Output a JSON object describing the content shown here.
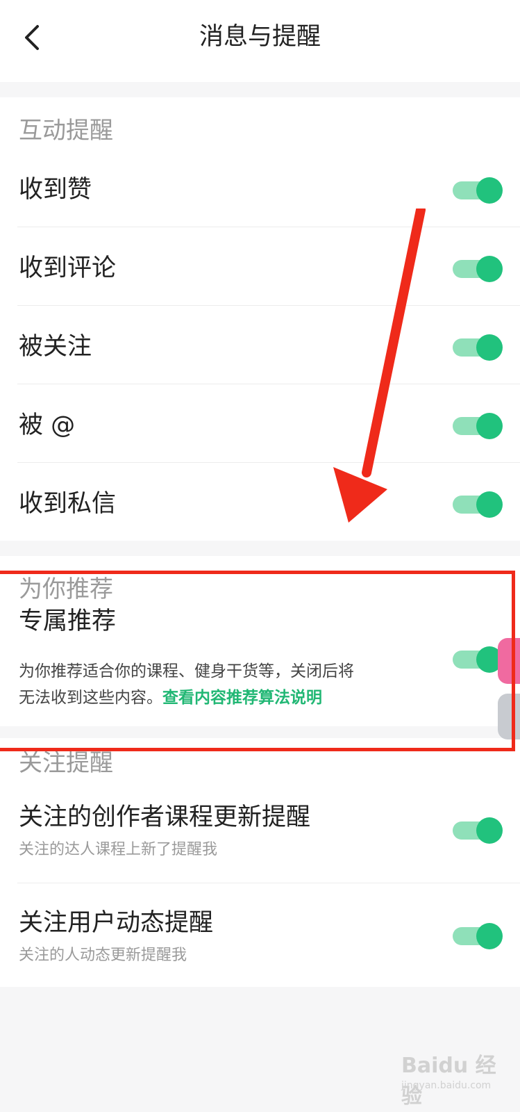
{
  "header": {
    "back_icon": "chevron-left-icon",
    "title": "消息与提醒"
  },
  "interaction": {
    "section_title": "互动提醒",
    "items": [
      {
        "label": "收到赞",
        "enabled": true
      },
      {
        "label": "收到评论",
        "enabled": true
      },
      {
        "label": "被关注",
        "enabled": true
      },
      {
        "label": "被 @",
        "enabled": true
      },
      {
        "label": "收到私信",
        "enabled": true
      }
    ]
  },
  "recommend": {
    "section_title": "为你推荐",
    "item": {
      "label": "专属推荐",
      "description": "为你推荐适合你的课程、健身干货等，关闭后将无法收到这些内容。",
      "link_text": "查看内容推荐算法说明",
      "enabled": true
    }
  },
  "follow": {
    "section_title": "关注提醒",
    "items": [
      {
        "label": "关注的创作者课程更新提醒",
        "sublabel": "关注的达人课程上新了提醒我",
        "enabled": true
      },
      {
        "label": "关注用户动态提醒",
        "sublabel": "关注的人动态更新提醒我",
        "enabled": true
      }
    ]
  },
  "colors": {
    "accent": "#21c27d",
    "annotation": "#ef2a1a"
  },
  "watermark": {
    "main": "Baidu 经验",
    "sub": "jingyan.baidu.com"
  }
}
